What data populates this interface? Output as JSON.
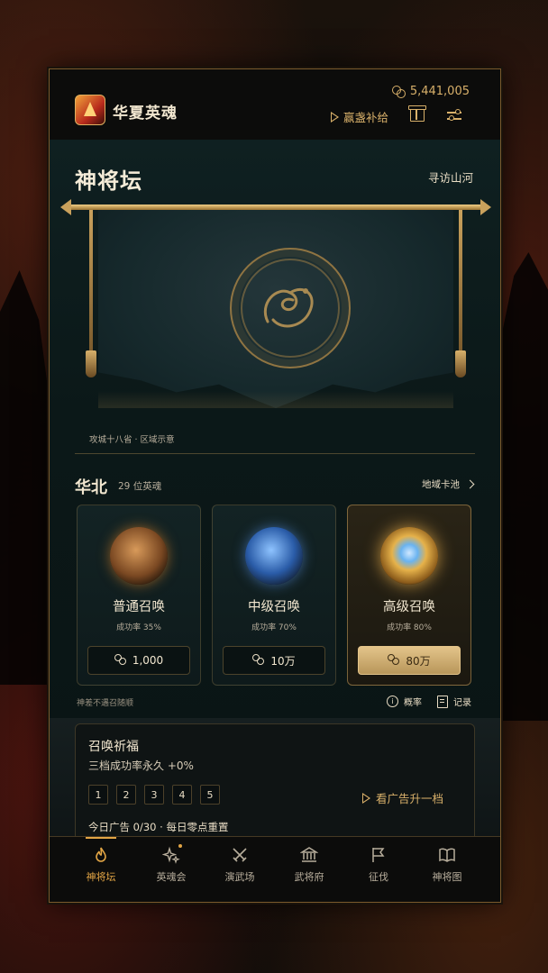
{
  "app": {
    "title": "华夏英魂"
  },
  "header": {
    "coins": "5,441,005",
    "ad_bonus": "赢盏补给"
  },
  "page": {
    "title": "神将坛",
    "explore": "寻访山河"
  },
  "banner": {
    "caption": "攻城十八省 · 区域示意"
  },
  "region": {
    "name": "华北",
    "count": "29 位英魂",
    "pool": "地域卡池"
  },
  "cards": [
    {
      "title": "普通召唤",
      "rate": "成功率 35%",
      "cost": "1,000"
    },
    {
      "title": "中级召唤",
      "rate": "成功率 70%",
      "cost": "10万"
    },
    {
      "title": "高级召唤",
      "rate": "成功率 80%",
      "cost": "80万"
    }
  ],
  "footer_links": {
    "pity": "神差不遇召随顺",
    "rate": "概率",
    "record": "记录"
  },
  "blessing": {
    "title": "召唤祈福",
    "subtitle": "三档成功率永久 +0%",
    "tiers": [
      "1",
      "2",
      "3",
      "4",
      "5"
    ],
    "watch_ad": "看广告升一档",
    "daily": "今日广告 0/30 · 每日零点重置"
  },
  "nav": [
    {
      "label": "神将坛",
      "icon": "flame-icon",
      "active": true
    },
    {
      "label": "英魂会",
      "icon": "sparkle-icon",
      "active": false
    },
    {
      "label": "演武场",
      "icon": "crossed-swords-icon",
      "active": false
    },
    {
      "label": "武将府",
      "icon": "temple-icon",
      "active": false
    },
    {
      "label": "征伐",
      "icon": "flag-icon",
      "active": false
    },
    {
      "label": "神将图",
      "icon": "book-icon",
      "active": false
    }
  ],
  "colors": {
    "accent": "#d8b06a",
    "active_nav": "#e2a545",
    "panel": "#0f2021"
  }
}
